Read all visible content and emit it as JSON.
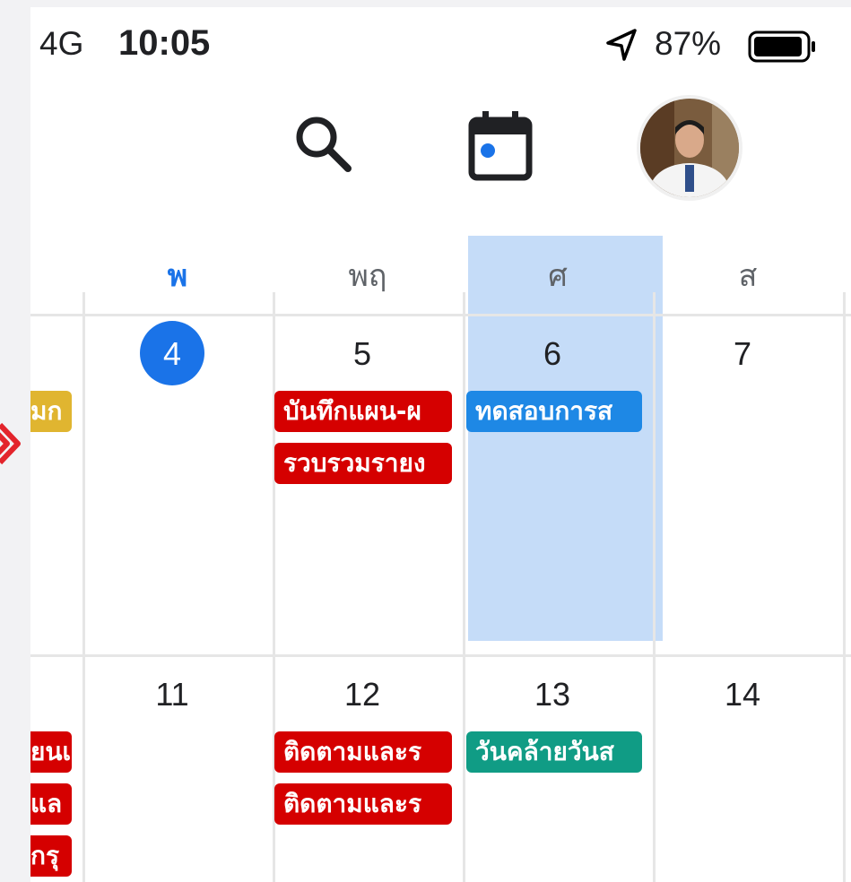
{
  "status_bar": {
    "network": "4G",
    "time": "10:05",
    "battery_percent": "87%",
    "icons": [
      "location-arrow-icon",
      "battery-icon"
    ]
  },
  "toolbar": {
    "icons": [
      "search-icon",
      "calendar-today-icon",
      "avatar"
    ]
  },
  "week_header": {
    "days": [
      {
        "label": "พ",
        "today": true
      },
      {
        "label": "พฤ",
        "today": false
      },
      {
        "label": "ศ",
        "today": false
      },
      {
        "label": "ส",
        "today": false
      }
    ]
  },
  "weeks": [
    {
      "dates": [
        "4",
        "5",
        "6",
        "7"
      ],
      "today_index": 0,
      "prev_events": [
        "มก"
      ],
      "events": {
        "thu": [
          "บันทึกแผน-ผ",
          "รวบรวมรายง"
        ],
        "fri": [
          "ทดสอบการส"
        ]
      }
    },
    {
      "dates": [
        "11",
        "12",
        "13",
        "14"
      ],
      "prev_events": [
        "ยนเ",
        "แล",
        "กรุ"
      ],
      "events": {
        "thu": [
          "ติดตามและร",
          "ติดตามและร"
        ],
        "fri": [
          "วันคล้ายวันส"
        ]
      }
    }
  ],
  "colors": {
    "today": "#1a73e8",
    "event_red": "#d50000",
    "event_blue": "#1e88e5",
    "event_teal": "#109c85",
    "event_yellow": "#e0b530",
    "selection": "#c5dcf8"
  }
}
